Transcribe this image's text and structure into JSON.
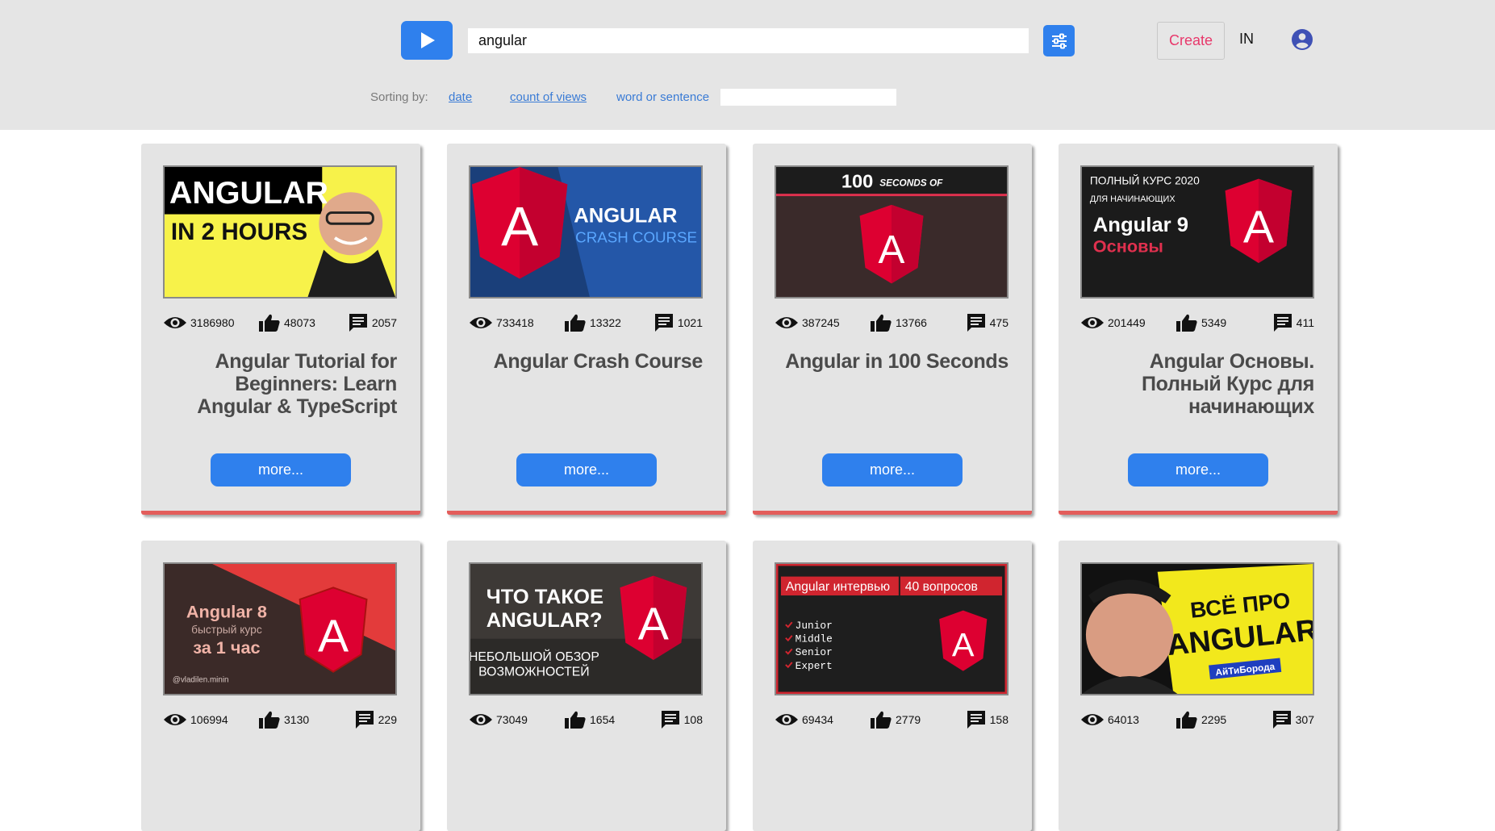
{
  "header": {
    "search_value": "angular",
    "create_label": "Create",
    "login_label": "IN",
    "sorting": {
      "label": "Sorting by:",
      "date": "date",
      "views": "count of views",
      "word": "word or sentence",
      "word_value": ""
    }
  },
  "colors": {
    "accent": "#2f80ed",
    "create": "#e8386b",
    "card_border": "#e35d5b",
    "header_bg": "#e5e5e5",
    "card_bg": "#e4e4e4"
  },
  "icons": [
    "play-icon",
    "filter-icon",
    "user-icon",
    "eye-icon",
    "thumb-up-icon",
    "comment-icon"
  ],
  "videos": [
    {
      "views": "3186980",
      "likes": "48073",
      "comments": "2057",
      "title": "Angular Tutorial for Beginners: Learn Angular & TypeScript",
      "more": "more...",
      "thumb": {
        "l1": "ANGULAR",
        "l2": "IN 2 HOURS"
      }
    },
    {
      "views": "733418",
      "likes": "13322",
      "comments": "1021",
      "title": "Angular Crash Course",
      "more": "more...",
      "thumb": {
        "logo": "A",
        "l1": "ANGULAR",
        "l2": "CRASH COURSE"
      }
    },
    {
      "views": "387245",
      "likes": "13766",
      "comments": "475",
      "title": "Angular in 100 Seconds",
      "more": "more...",
      "thumb": {
        "l1": "100",
        "l2": "SECONDS OF",
        "logo": "A"
      }
    },
    {
      "views": "201449",
      "likes": "5349",
      "comments": "411",
      "title": "Angular Основы. Полный Курс для начинающих",
      "more": "more...",
      "thumb": {
        "l1": "ПОЛНЫЙ КУРС 2020",
        "l2": "ДЛЯ НАЧИНАЮЩИХ",
        "l3": "Angular 9",
        "l4": "Основы",
        "logo": "A"
      }
    },
    {
      "views": "106994",
      "likes": "3130",
      "comments": "229",
      "thumb": {
        "l1": "Angular 8",
        "l2": "быстрый курс",
        "l3": "за 1 час",
        "l4": "@vladilen.minin",
        "logo": "A"
      }
    },
    {
      "views": "73049",
      "likes": "1654",
      "comments": "108",
      "thumb": {
        "l1": "ЧТО ТАКОЕ",
        "l2": "ANGULAR?",
        "l3": "НЕБОЛЬШОЙ ОБЗОР",
        "l4": "ВОЗМОЖНОСТЕЙ",
        "logo": "A"
      }
    },
    {
      "views": "69434",
      "likes": "2779",
      "comments": "158",
      "thumb": {
        "l1": "Angular интервью",
        "l2": "40 вопросов",
        "items": [
          "Junior",
          "Middle",
          "Senior",
          "Expert"
        ],
        "logo": "A"
      }
    },
    {
      "views": "64013",
      "likes": "2295",
      "comments": "307",
      "thumb": {
        "l1": "ВСЁ ПРО",
        "l2": "ANGULAR",
        "l3": "АйТиБорода"
      }
    }
  ]
}
